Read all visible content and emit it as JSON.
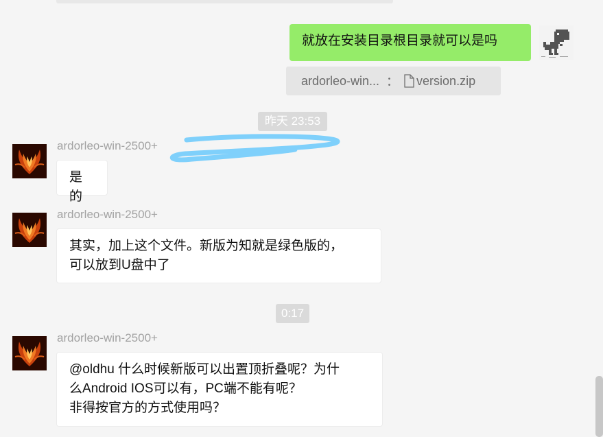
{
  "chat": {
    "self_message": "就放在安装目录根目录就可以是吗",
    "quote": {
      "sender": "ardorleo-win...",
      "separator": "：",
      "file": "version.zip"
    },
    "timestamps": [
      "昨天 23:53",
      "0:17"
    ],
    "messages": [
      {
        "sender": "ardorleo-win-2500+",
        "lines": [
          "是的"
        ]
      },
      {
        "sender": "ardorleo-win-2500+",
        "lines": [
          "其实，加上这个文件。新版为知就是绿色版的，",
          "可以放到U盘中了"
        ]
      },
      {
        "sender": "ardorleo-win-2500+",
        "lines": [
          "@oldhu 什么时候新版可以出置顶折叠呢？为什",
          "么Android IOS可以有，PC端不能有呢？",
          "非得按官方的方式使用吗？"
        ]
      }
    ]
  },
  "colors": {
    "self_bubble": "#95ec69",
    "background": "#f5f5f5",
    "redaction_scribble": "#7fd0fb"
  },
  "icons": {
    "self_avatar": "pixel-dinosaur-icon",
    "peer_avatar": "fire-phoenix-icon",
    "file": "document-file-icon"
  }
}
